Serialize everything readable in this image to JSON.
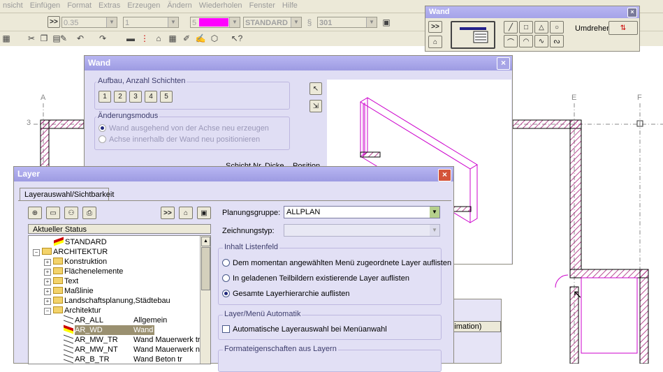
{
  "menubar": [
    "nsicht",
    "Einfügen",
    "Format",
    "Extras",
    "Erzeugen",
    "Ändern",
    "Wiederholen",
    "Fenster",
    "Hilfe"
  ],
  "toolbar": {
    "more": ">>",
    "pen_value": "0.35",
    "line_value": "1",
    "color_value": "5",
    "style_value": "STANDARD",
    "hatch_value": "301",
    "color_accent": "#ff00ff"
  },
  "grid": {
    "labels": [
      "A",
      "E",
      "F",
      "3"
    ]
  },
  "wand_palette": {
    "title": "Wand",
    "more": ">>",
    "umdrehen": "Umdrehen"
  },
  "wand_dialog": {
    "title": "Wand",
    "aufbau_group": "Aufbau, Anzahl Schichten",
    "layer_buttons": [
      "1",
      "2",
      "3",
      "4",
      "5"
    ],
    "aenderung_group": "Änderungsmodus",
    "radio_1": "Wand ausgehend von der Achse neu erzeugen",
    "radio_2": "Achse innerhalb der Wand neu positionieren",
    "col_schicht": "Schicht Nr.",
    "col_dicke": "Dicke",
    "col_position": "Position",
    "animation_tab": "e (Animation)"
  },
  "layer_dialog": {
    "title": "Layer",
    "tab": "Layerauswahl/Sichtbarkeit",
    "more": ">>",
    "status_header": "Aktueller Status",
    "tree": [
      {
        "label": "STANDARD",
        "desc": "",
        "level": 1,
        "kind": "layer"
      },
      {
        "label": "ARCHITEKTUR",
        "desc": "",
        "level": 0,
        "kind": "folder-open"
      },
      {
        "label": "Konstruktion",
        "desc": "",
        "level": 1,
        "kind": "folder"
      },
      {
        "label": "Flächenelemente",
        "desc": "",
        "level": 1,
        "kind": "folder"
      },
      {
        "label": "Text",
        "desc": "",
        "level": 1,
        "kind": "folder"
      },
      {
        "label": "Maßlinie",
        "desc": "",
        "level": 1,
        "kind": "folder"
      },
      {
        "label": "Landschaftsplanung,Städtebau",
        "desc": "",
        "level": 1,
        "kind": "folder"
      },
      {
        "label": "Architektur",
        "desc": "",
        "level": 1,
        "kind": "folder-open"
      },
      {
        "label": "AR_ALL",
        "desc": "Allgemein",
        "level": 2,
        "kind": "layer"
      },
      {
        "label": "AR_WD",
        "desc": "Wand",
        "level": 2,
        "kind": "layer-selected"
      },
      {
        "label": "AR_MW_TR",
        "desc": "Wand Mauerwerk tr",
        "level": 2,
        "kind": "layer"
      },
      {
        "label": "AR_MW_NT",
        "desc": "Wand Mauerwerk nt",
        "level": 2,
        "kind": "layer"
      },
      {
        "label": "AR_B_TR",
        "desc": "Wand Beton tr",
        "level": 2,
        "kind": "layer"
      }
    ],
    "planungsgruppe_label": "Planungsgruppe:",
    "planungsgruppe_value": "ALLPLAN",
    "zeichnungstyp_label": "Zeichnungstyp:",
    "zeichnungstyp_value": "",
    "inhalt_group": "Inhalt Listenfeld",
    "inhalt_options": [
      "Dem momentan angewählten Menü zugeordnete Layer auflisten",
      "In geladenen Teilbildern existierende Layer auflisten",
      "Gesamte Layerhierarchie auflisten"
    ],
    "inhalt_selected": 2,
    "automatik_group": "Layer/Menü Automatik",
    "automatik_check": "Automatische Layerauswahl bei Menüanwahl",
    "format_group": "Formateigenschaften aus Layern"
  }
}
